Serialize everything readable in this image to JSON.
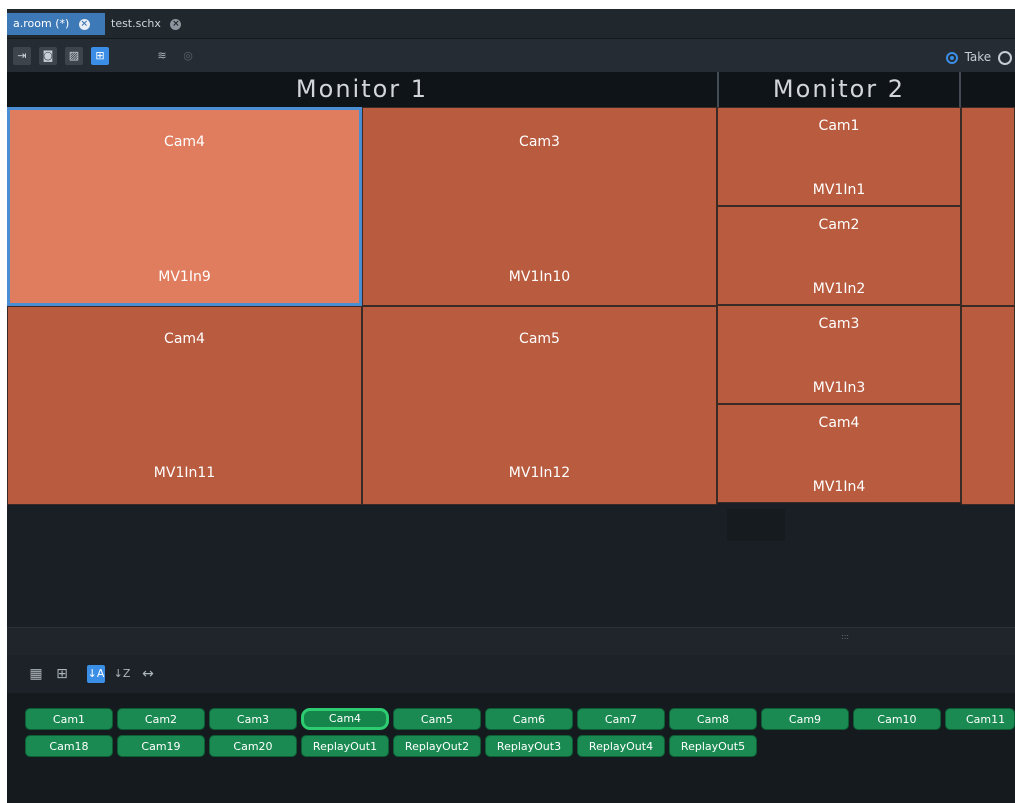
{
  "tabs": [
    {
      "label": "a.room (*)",
      "active": true
    },
    {
      "label": "test.schx",
      "active": false
    }
  ],
  "toolbar": {
    "take_label": "Take",
    "icons": [
      "exit-icon",
      "add-camera-icon",
      "image-icon",
      "grid-select-icon",
      "layers-icon",
      "search-icon"
    ]
  },
  "monitors": [
    {
      "title": "Monitor 1"
    },
    {
      "title": "Monitor 2"
    }
  ],
  "monitor1_cells": [
    {
      "source": "Cam4",
      "input": "MV1In9",
      "selected": true
    },
    {
      "source": "Cam3",
      "input": "MV1In10",
      "selected": false
    },
    {
      "source": "Cam4",
      "input": "MV1In11",
      "selected": false
    },
    {
      "source": "Cam5",
      "input": "MV1In12",
      "selected": false
    }
  ],
  "monitor2_cells": [
    {
      "source": "Cam1",
      "input": "MV1In1"
    },
    {
      "source": "Cam2",
      "input": "MV1In2"
    },
    {
      "source": "Cam3",
      "input": "MV1In3"
    },
    {
      "source": "Cam4",
      "input": "MV1In4"
    }
  ],
  "sources_row1": [
    "Cam1",
    "Cam2",
    "Cam3",
    "Cam4",
    "Cam5",
    "Cam6",
    "Cam7",
    "Cam8",
    "Cam9",
    "Cam10",
    "Cam11"
  ],
  "sources_row2": [
    "Cam18",
    "Cam19",
    "Cam20",
    "ReplayOut1",
    "ReplayOut2",
    "ReplayOut3",
    "ReplayOut4",
    "ReplayOut5"
  ],
  "selected_source": "Cam4",
  "colors": {
    "tile": "#b85b3f",
    "tile_selected": "#e07d5e",
    "source_button": "#1a8a52",
    "accent": "#3a8ee6"
  }
}
